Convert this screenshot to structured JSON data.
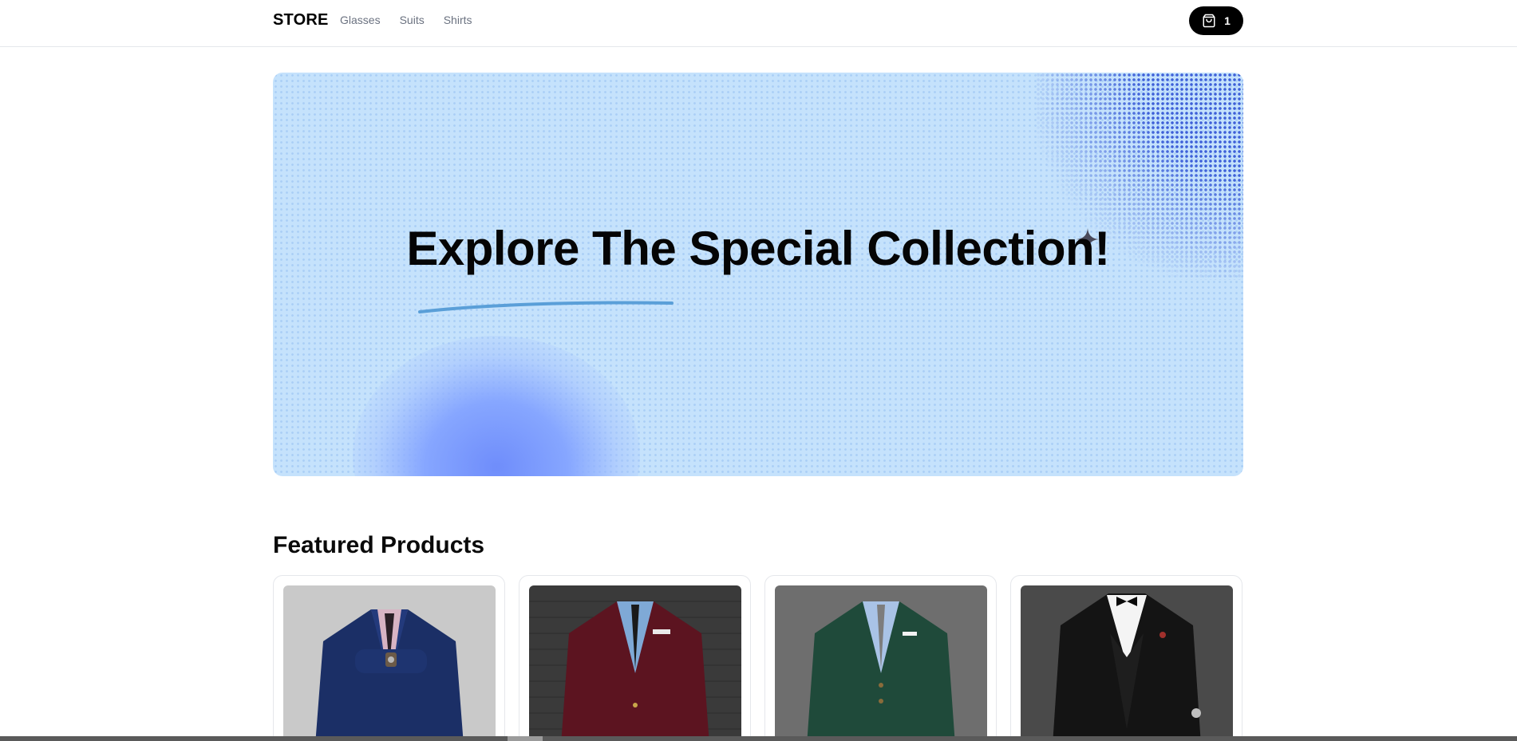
{
  "header": {
    "brand": "STORE",
    "nav": [
      {
        "label": "Glasses"
      },
      {
        "label": "Suits"
      },
      {
        "label": "Shirts"
      }
    ],
    "cart": {
      "icon": "shopping-bag-icon",
      "count": "1"
    }
  },
  "hero": {
    "title": "Explore The Special Collection!",
    "background_color": "#c5e2fc",
    "accent_color": "#3d5fd8",
    "decor": [
      "swoosh-line",
      "sparkle-icon",
      "halftone-dots"
    ]
  },
  "featured": {
    "title": "Featured Products",
    "products": [
      {
        "image": "navy-checked-suit",
        "suit_color": "#1b2f66",
        "bg": "#c9c9c9"
      },
      {
        "image": "burgundy-suit",
        "suit_color": "#5c1420",
        "bg": "#3a3a3a"
      },
      {
        "image": "green-suit",
        "suit_color": "#1f4a3a",
        "bg": "#6e6e6e"
      },
      {
        "image": "black-tuxedo",
        "suit_color": "#141414",
        "bg": "#4a4a4a"
      }
    ]
  }
}
